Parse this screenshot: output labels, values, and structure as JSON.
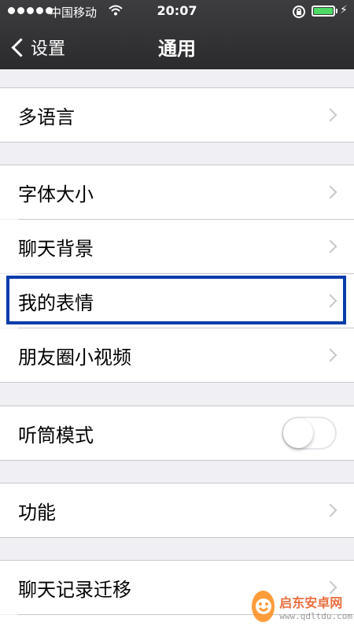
{
  "status_bar": {
    "carrier": "中国移动",
    "time": "20:07",
    "battery_color": "#4cd964"
  },
  "nav": {
    "back_label": "设置",
    "title": "通用"
  },
  "rows": {
    "multilang": "多语言",
    "font_size": "字体大小",
    "chat_background": "聊天背景",
    "my_stickers": "我的表情",
    "moments_video": "朋友圈小视频",
    "earpiece_mode": "听筒模式",
    "features": "功能",
    "chat_migration": "聊天记录迁移"
  },
  "toggles": {
    "earpiece_mode_on": false
  },
  "annotation": {
    "highlight_color": "#0a3cac"
  },
  "watermark": {
    "title": "启东安卓网",
    "url": "www.qdltdu.com"
  }
}
